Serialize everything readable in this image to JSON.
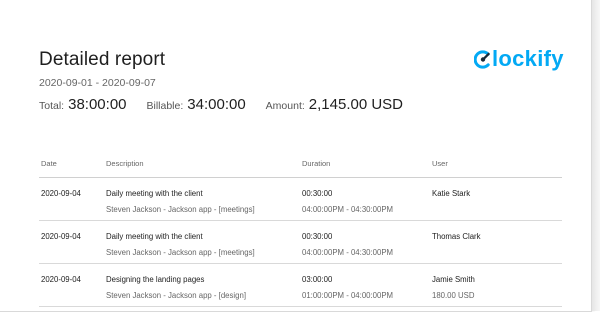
{
  "report": {
    "title": "Detailed report",
    "date_range": "2020-09-01 - 2020-09-07",
    "totals": {
      "total_label": "Total:",
      "total_value": "38:00:00",
      "billable_label": "Billable:",
      "billable_value": "34:00:00",
      "amount_label": "Amount:",
      "amount_value": "2,145.00 USD"
    }
  },
  "logo": {
    "text": "lockify",
    "icon": "clockify-logo-icon",
    "color": "#03a9f4"
  },
  "table": {
    "columns": [
      "Date",
      "Description",
      "Duration",
      "User"
    ],
    "rows": [
      {
        "date": "2020-09-04",
        "description": "Daily meeting with the client",
        "details": "Steven Jackson - Jackson app - [meetings]",
        "duration": "00:30:00",
        "time_range": "04:00:00PM - 04:30:00PM",
        "user": "Katie Stark",
        "amount": ""
      },
      {
        "date": "2020-09-04",
        "description": "Daily meeting with the client",
        "details": "Steven Jackson - Jackson app - [meetings]",
        "duration": "00:30:00",
        "time_range": "04:00:00PM - 04:30:00PM",
        "user": "Thomas Clark",
        "amount": ""
      },
      {
        "date": "2020-09-04",
        "description": "Designing the landing pages",
        "details": "Steven Jackson - Jackson app - [design]",
        "duration": "03:00:00",
        "time_range": "01:00:00PM - 04:00:00PM",
        "user": "Jamie Smith",
        "amount": "180.00 USD"
      }
    ]
  }
}
